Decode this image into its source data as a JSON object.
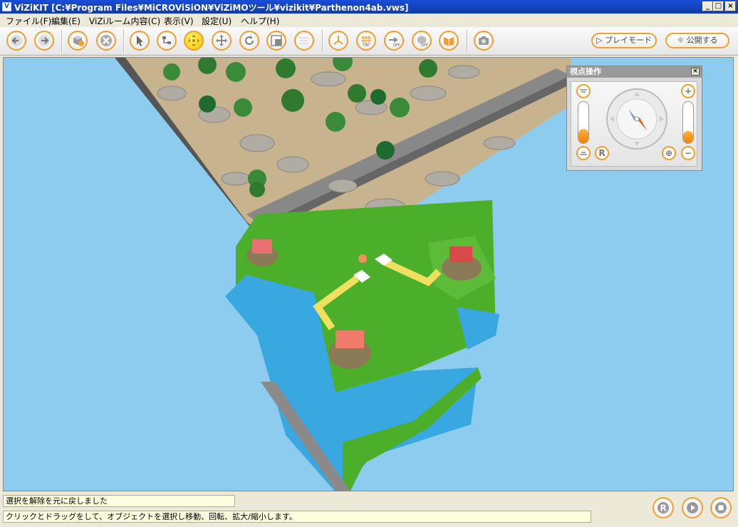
{
  "window": {
    "title": "ViZiKIT [C:¥Program Files¥MiCROViSiON¥ViZiMOツール¥vizikit¥Parthenon4ab.vws]",
    "icon_label": "V"
  },
  "menu": {
    "items": [
      {
        "label": "ファイル(F)"
      },
      {
        "label": "編集(E)"
      },
      {
        "label": "ViZiルーム内容(C)"
      },
      {
        "label": "表示(V)"
      },
      {
        "label": "設定(U)"
      },
      {
        "label": "ヘルプ(H)"
      }
    ]
  },
  "toolbar": {
    "play_mode_label": "▷ プレイモード",
    "publish_label": "☼ 公開する",
    "accent_color": "#f0a030"
  },
  "viewpoint_panel": {
    "title": "視点操作",
    "close_label": "×",
    "reset_label": "R",
    "zoom_in_label": "+",
    "zoom_out_label": "−",
    "center_label": "⊕",
    "tilt_level": 0.35,
    "zoom_level": 0.3
  },
  "status": {
    "message": "選択を解除を元に戻しました",
    "hint": "クリックとドラッグをして、オブジェクトを選択し移動、回転、拡大/縮小します。"
  },
  "playback": {
    "reset_label": "R"
  },
  "colors": {
    "sky": "#8dccee",
    "grass": "#4caf2a",
    "water": "#3aa8e0",
    "path": "#f0e060",
    "accent": "#f0a030"
  }
}
